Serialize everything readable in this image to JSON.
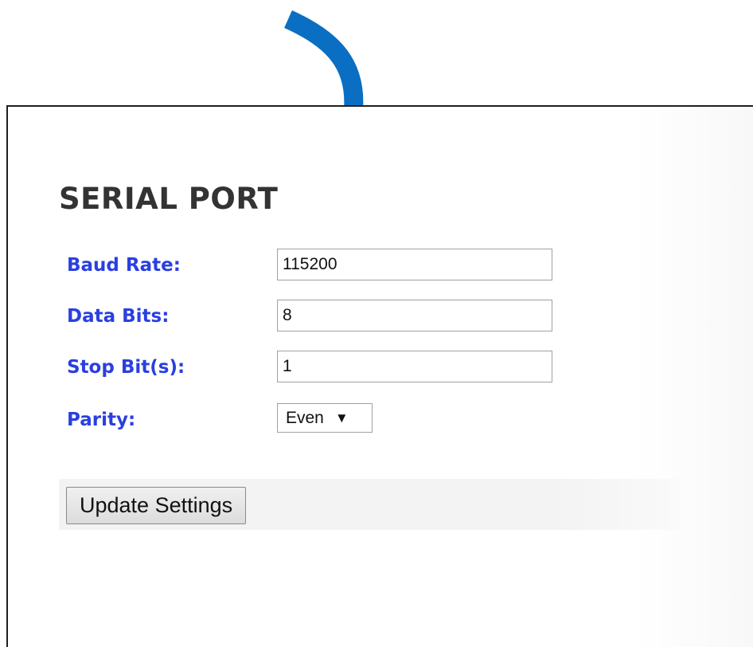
{
  "panel": {
    "title": "SERIAL PORT"
  },
  "fields": {
    "baud_rate": {
      "label": "Baud Rate:",
      "value": "115200"
    },
    "data_bits": {
      "label": "Data Bits:",
      "value": "8"
    },
    "stop_bits": {
      "label": "Stop Bit(s):",
      "value": "1"
    },
    "parity": {
      "label": "Parity:",
      "selected": "Even",
      "arrow": "▼"
    }
  },
  "actions": {
    "update_label": "Update Settings"
  },
  "colors": {
    "label_blue": "#2a3fe0",
    "arrow_blue": "#0a6fc2",
    "title_gray": "#333333"
  },
  "icons": {
    "callout": "curved-arrow-icon"
  }
}
